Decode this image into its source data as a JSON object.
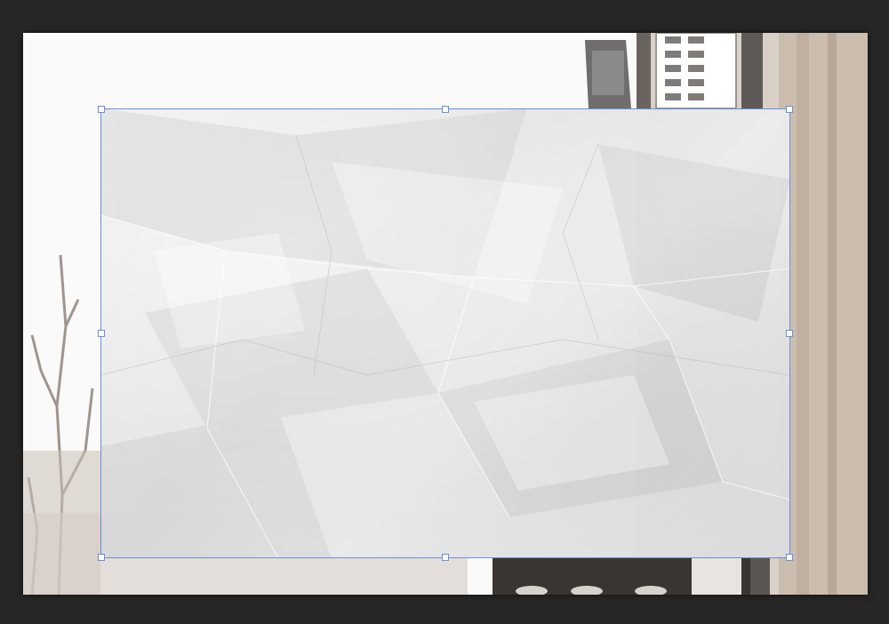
{
  "workspace": {
    "background": "#262626"
  },
  "document": {
    "layers": [
      {
        "name": "background-photo",
        "description_icon": "image-layer-icon"
      },
      {
        "name": "crumpled-paper",
        "description_icon": "image-layer-icon"
      }
    ]
  },
  "transform": {
    "accent_color": "#6b8fd6",
    "handles": [
      "top-left",
      "top-center",
      "top-right",
      "middle-left",
      "middle-right",
      "bottom-left",
      "bottom-center",
      "bottom-right"
    ]
  }
}
